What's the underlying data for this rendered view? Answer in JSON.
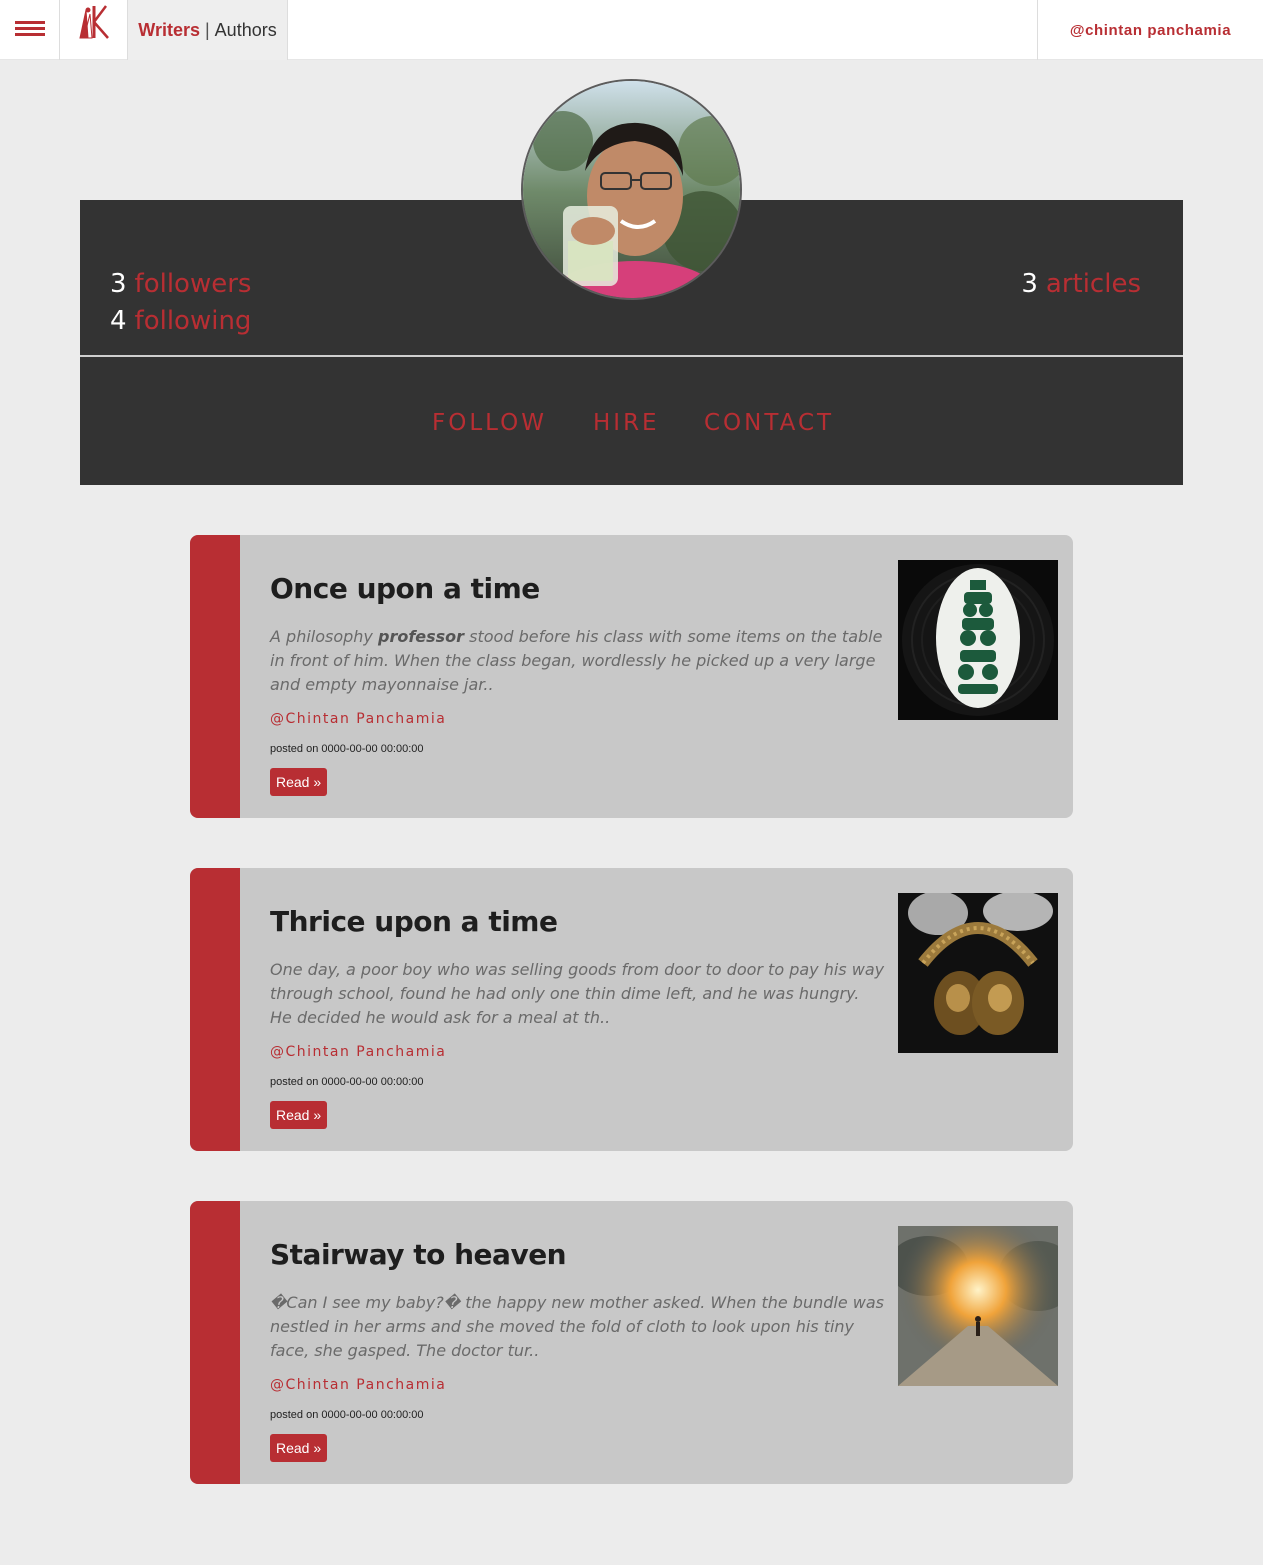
{
  "nav": {
    "brand_primary": "Writers",
    "brand_separator": "|",
    "brand_secondary": "Authors",
    "user_handle": "@chintan panchamia"
  },
  "profile": {
    "followers_count": "3",
    "followers_label": "followers",
    "following_count": "4",
    "following_label": "following",
    "articles_count": "3",
    "articles_label": "articles",
    "actions": [
      "FOLLOW",
      "HIRE",
      "CONTACT"
    ]
  },
  "articles": [
    {
      "title": "Once upon a time",
      "excerpt_before": "A philosophy ",
      "excerpt_bold": "professor",
      "excerpt_after": " stood before his class with some items on the table in front of him. When the class began, wordlessly he picked up a very large and empty mayonnaise jar..",
      "author": "@Chintan Panchamia",
      "posted": "posted on 0000-00-00 00:00:00",
      "read_label": "Read »"
    },
    {
      "title": "Thrice upon a time",
      "excerpt_before": "One day, a poor boy who was selling goods from door to door to pay his way through school, found he had only one thin dime left, and he was hungry. He decided he would ask for a meal at th..",
      "excerpt_bold": "",
      "excerpt_after": "",
      "author": "@Chintan Panchamia",
      "posted": "posted on 0000-00-00 00:00:00",
      "read_label": "Read »"
    },
    {
      "title": "Stairway to heaven",
      "excerpt_before": "�Can I see my baby?� the happy new mother asked. When the bundle was nestled in her arms and she moved the fold of cloth to look upon his tiny face, she gasped. The doctor tur..",
      "excerpt_bold": "",
      "excerpt_after": "",
      "author": "@Chintan Panchamia",
      "posted": "posted on 0000-00-00 00:00:00",
      "read_label": "Read »"
    }
  ],
  "colors": {
    "accent": "#b82e33",
    "panel": "#333333",
    "card": "#c8c8c8",
    "background": "#ececec"
  }
}
